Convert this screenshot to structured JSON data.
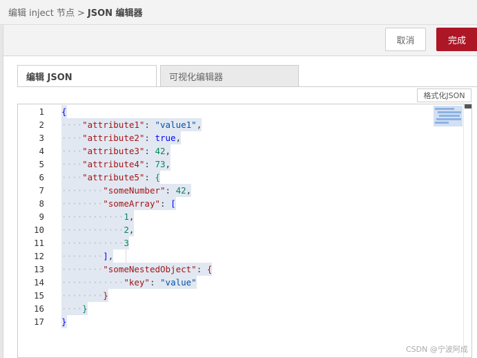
{
  "breadcrumb": {
    "parent": "编辑 inject 节点",
    "separator": ">",
    "current": "JSON 编辑器"
  },
  "toolbar": {
    "cancel_label": "取消",
    "done_label": "完成"
  },
  "tabs": [
    {
      "label": "编辑 JSON",
      "active": true
    },
    {
      "label": "可视化编辑器",
      "active": false
    }
  ],
  "format_button_label": "格式化JSON",
  "editor": {
    "line_numbers": [
      "1",
      "2",
      "3",
      "4",
      "5",
      "6",
      "7",
      "8",
      "9",
      "10",
      "11",
      "12",
      "13",
      "14",
      "15",
      "16",
      "17"
    ],
    "lines": [
      {
        "indent": "",
        "parts": [
          {
            "t": "b",
            "v": "{"
          }
        ]
      },
      {
        "indent": "····",
        "parts": [
          {
            "t": "k",
            "v": "\"attribute1\""
          },
          {
            "t": "p",
            "v": ": "
          },
          {
            "t": "s",
            "v": "\"value1\""
          },
          {
            "t": "p",
            "v": ","
          }
        ]
      },
      {
        "indent": "····",
        "parts": [
          {
            "t": "k",
            "v": "\"attribute2\""
          },
          {
            "t": "p",
            "v": ": "
          },
          {
            "t": "b",
            "v": "true"
          },
          {
            "t": "p",
            "v": ","
          }
        ]
      },
      {
        "indent": "····",
        "parts": [
          {
            "t": "k",
            "v": "\"attribute3\""
          },
          {
            "t": "p",
            "v": ": "
          },
          {
            "t": "n",
            "v": "42"
          },
          {
            "t": "p",
            "v": ","
          }
        ]
      },
      {
        "indent": "····",
        "parts": [
          {
            "t": "k",
            "v": "\"attribute4\""
          },
          {
            "t": "p",
            "v": ": "
          },
          {
            "t": "n",
            "v": "73"
          },
          {
            "t": "p",
            "v": ","
          }
        ]
      },
      {
        "indent": "····",
        "parts": [
          {
            "t": "k",
            "v": "\"attribute5\""
          },
          {
            "t": "p",
            "v": ": "
          },
          {
            "t": "n",
            "v": "{"
          }
        ]
      },
      {
        "indent": "········",
        "parts": [
          {
            "t": "k",
            "v": "\"someNumber\""
          },
          {
            "t": "p",
            "v": ": "
          },
          {
            "t": "n",
            "v": "42"
          },
          {
            "t": "p",
            "v": ","
          }
        ]
      },
      {
        "indent": "········",
        "parts": [
          {
            "t": "k",
            "v": "\"someArray\""
          },
          {
            "t": "p",
            "v": ": "
          },
          {
            "t": "b",
            "v": "["
          }
        ]
      },
      {
        "indent": "············",
        "parts": [
          {
            "t": "n",
            "v": "1"
          },
          {
            "t": "p",
            "v": ","
          }
        ]
      },
      {
        "indent": "············",
        "parts": [
          {
            "t": "n",
            "v": "2"
          },
          {
            "t": "p",
            "v": ","
          }
        ]
      },
      {
        "indent": "············",
        "parts": [
          {
            "t": "n",
            "v": "3"
          }
        ]
      },
      {
        "indent": "········",
        "parts": [
          {
            "t": "b",
            "v": "]"
          },
          {
            "t": "p",
            "v": ","
          }
        ]
      },
      {
        "indent": "········",
        "parts": [
          {
            "t": "k",
            "v": "\"someNestedObject\""
          },
          {
            "t": "p",
            "v": ": "
          },
          {
            "t": "k",
            "v": "{"
          }
        ]
      },
      {
        "indent": "············",
        "parts": [
          {
            "t": "k",
            "v": "\"key\""
          },
          {
            "t": "p",
            "v": ": "
          },
          {
            "t": "s",
            "v": "\"value\""
          }
        ]
      },
      {
        "indent": "········",
        "parts": [
          {
            "t": "k",
            "v": "}"
          }
        ]
      },
      {
        "indent": "····",
        "parts": [
          {
            "t": "n",
            "v": "}"
          }
        ]
      },
      {
        "indent": "",
        "parts": [
          {
            "t": "b",
            "v": "}"
          }
        ]
      }
    ]
  },
  "watermark": "CSDN @宁波阿成",
  "colors": {
    "accent": "#ad1625",
    "selection": "#e1e8f2",
    "key": "#a31515",
    "string": "#0451a5",
    "number": "#098658",
    "bracket": "#0000ff"
  }
}
